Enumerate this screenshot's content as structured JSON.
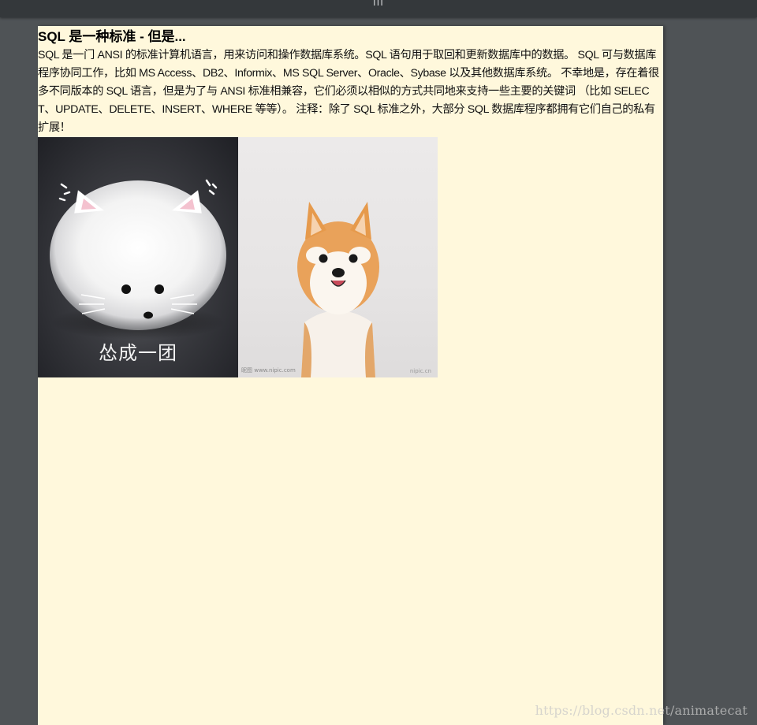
{
  "topbar": {
    "title": "|||"
  },
  "article": {
    "title": "SQL 是一种标准 - 但是...",
    "body": "SQL 是一门 ANSI 的标准计算机语言，用来访问和操作数据库系统。SQL 语句用于取回和更新数据库中的数据。 SQL 可与数据库程序协同工作，比如 MS Access、DB2、Informix、MS SQL Server、Oracle、Sybase 以及其他数据库系统。 不幸地是，存在着很多不同版本的 SQL 语言，但是为了与 ANSI 标准相兼容，它们必须以相似的方式共同地来支持一些主要的关键词 （比如 SELECT、UPDATE、DELETE、INSERT、WHERE 等等）。 注释：除了 SQL 标准之外，大部分 SQL 数据库程序都拥有它们自己的私有扩展！"
  },
  "images": {
    "cat": {
      "icon": "fluffy-white-cat-image",
      "caption": "怂成一团"
    },
    "dog": {
      "icon": "shiba-inu-dog-image",
      "credit_left": "昵图 www.nipic.com",
      "credit_right": "nipic.cn"
    }
  },
  "watermark": {
    "text": "https://blog.csdn.net/animatecat"
  },
  "colors": {
    "page_background": "#fff8dc",
    "app_background": "#4f5356",
    "topbar": "#34383b"
  }
}
